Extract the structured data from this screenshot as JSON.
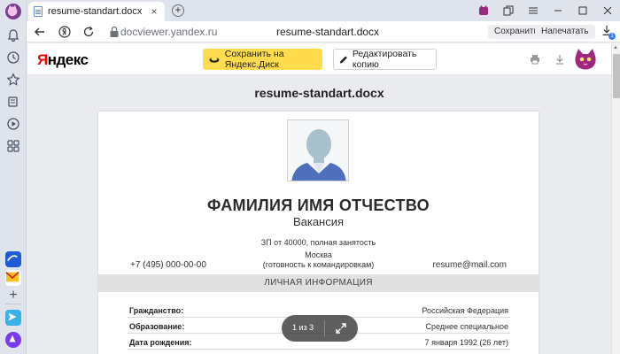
{
  "browser": {
    "tab_title": "resume-standart.docx",
    "tab_close": "×",
    "new_tab": "+",
    "url": "docviewer.yandex.ru",
    "page_title": "resume-standart.docx",
    "save_label": "Сохранить",
    "print_label": "Напечатать",
    "downloads_badge": "1"
  },
  "viewer": {
    "logo_y": "Я",
    "logo_rest": "ндекс",
    "save_to_disk": "Сохранить на Яндекс.Диск",
    "edit_copy": "Редактировать копию",
    "doc_name": "resume-standart.docx"
  },
  "resume": {
    "full_name": "ФАМИЛИЯ ИМЯ ОТЧЕСТВО",
    "vacancy": "Вакансия",
    "salary": "ЗП от 40000, полная занятость",
    "city": "Москва",
    "relocation": "(готовность к командировкам)",
    "phone": "+7 (495) 000-00-00",
    "email": "resume@mail.com",
    "section_title": "ЛИЧНАЯ ИНФОРМАЦИЯ",
    "rows": [
      {
        "key": "Гражданство:",
        "value": "Российская Федерация"
      },
      {
        "key": "Образование:",
        "value": "Среднее специальное"
      },
      {
        "key": "Дата рождения:",
        "value": "7 января 1992 (26 лет)"
      }
    ]
  },
  "pager": {
    "counter": "1 из 3"
  }
}
